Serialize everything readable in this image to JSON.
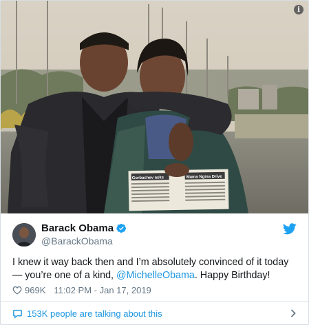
{
  "author": {
    "display_name": "Barack Obama",
    "handle": "@BarackObama"
  },
  "tweet": {
    "text_before": "I knew it way back then and I’m absolutely convinced of it today — you’re one of a kind, ",
    "mention": "@MichelleObama",
    "text_after": ". Happy Birthday!"
  },
  "meta": {
    "likes": "969K",
    "timestamp": "11:02 PM - Jan 17, 2019"
  },
  "footer": {
    "talking_text": "153K people are talking about this"
  },
  "photo": {
    "newspaper_headline_left": "Gorbachev asks",
    "newspaper_headline_right": "Mama Ngina Drive"
  },
  "icons": {
    "info": "info-icon",
    "verified": "verified-badge-icon",
    "brand": "twitter-bird-icon",
    "like": "heart-icon",
    "replies": "speech-bubble-icon",
    "more": "chevron-right-icon"
  },
  "colors": {
    "link": "#1b95e0",
    "text": "#14171a",
    "muted": "#657786"
  }
}
